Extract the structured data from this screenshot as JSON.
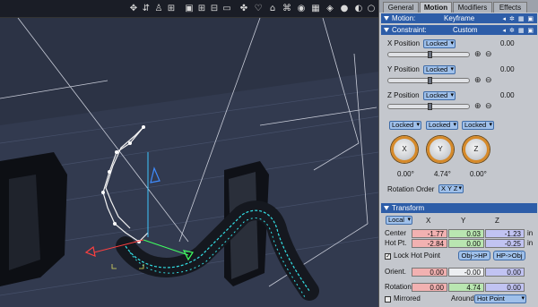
{
  "toolbar": {
    "icons": [
      "move-tool-icon",
      "rotate-tool-icon",
      "scale-tool-icon",
      "view-single-icon",
      "view-quad-icon",
      "view-split-icon",
      "view-wide-icon",
      "bone-icon",
      "light-icon",
      "camera-icon",
      "globe-icon",
      "cube-icon",
      "shade-solid-icon",
      "shade-smooth-icon",
      "shade-texture-icon",
      "shade-wire-icon"
    ]
  },
  "tabs": [
    "General",
    "Motion",
    "Modifiers",
    "Effects"
  ],
  "active_tab": "Motion",
  "motion": {
    "label": "Motion:",
    "value": "Keyframe"
  },
  "constraint": {
    "label": "Constraint:",
    "value": "Custom",
    "x": {
      "label": "X Position",
      "mode": "Locked",
      "value": "0.00"
    },
    "y": {
      "label": "Y Position",
      "mode": "Locked",
      "value": "0.00"
    },
    "z": {
      "label": "Z Position",
      "mode": "Locked",
      "value": "0.00"
    },
    "rot_modes": [
      "Locked",
      "Locked",
      "Locked"
    ],
    "dials": [
      {
        "axis": "X",
        "value": "0.00°"
      },
      {
        "axis": "Y",
        "value": "4.74°"
      },
      {
        "axis": "Z",
        "value": "0.00°"
      }
    ],
    "rotation_order_label": "Rotation Order",
    "rotation_order": "X Y Z"
  },
  "transform": {
    "header": "Transform",
    "space": "Local",
    "cols": [
      "X",
      "Y",
      "Z"
    ],
    "center": {
      "label": "Center",
      "x": "-1.77",
      "y": "0.03",
      "z": "-1.23",
      "unit": "in"
    },
    "hot_pt": {
      "label": "Hot Pt.",
      "x": "-2.84",
      "y": "0.00",
      "z": "-0.25",
      "unit": "in"
    },
    "lock_hot_point": "Lock Hot Point",
    "obj_hp": "Obj->HP",
    "hp_obj": "HP->Obj",
    "orient": {
      "label": "Orient.",
      "x": "0.00",
      "y": "-0.00",
      "z": "0.00"
    },
    "rotation": {
      "label": "Rotation",
      "x": "0.00",
      "y": "4.74",
      "z": "0.00"
    },
    "mirrored": "Mirrored",
    "around_label": "Around",
    "around": "Hot Point"
  }
}
